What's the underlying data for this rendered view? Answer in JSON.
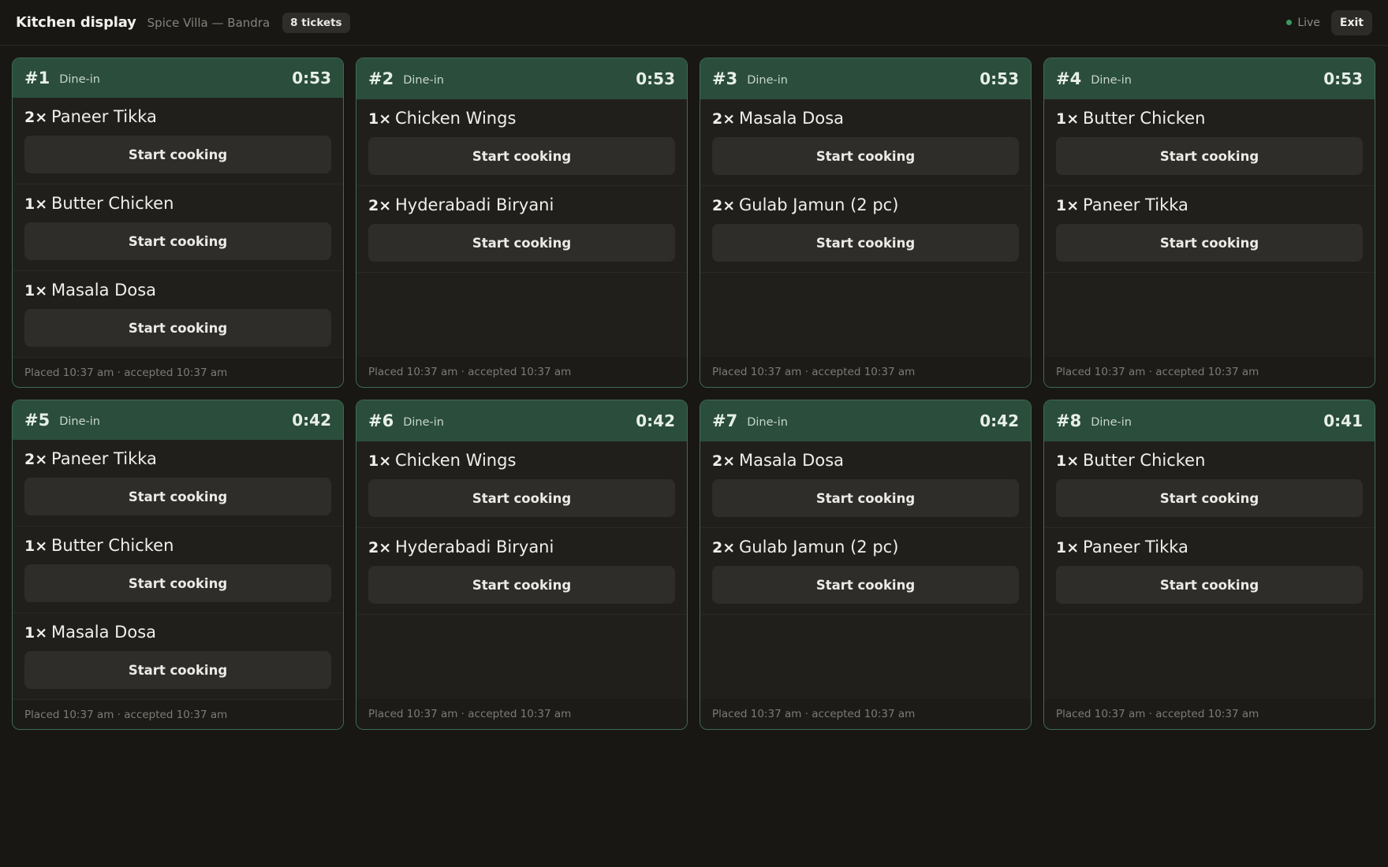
{
  "header": {
    "title": "Kitchen display",
    "location": "Spice Villa — Bandra",
    "ticket_count": "8 tickets",
    "live_label": "Live",
    "exit_label": "Exit"
  },
  "colors": {
    "background": "#181714",
    "ticket_header": "#2b4d3b",
    "ticket_border": "#3e6d52",
    "live_dot": "#3b9a61",
    "button": "#2f2d2a"
  },
  "tickets": [
    {
      "number": "#1",
      "type": "Dine-in",
      "timer": "0:53",
      "items": [
        {
          "qty": "2×",
          "name": "Paneer Tikka",
          "action": "Start cooking"
        },
        {
          "qty": "1×",
          "name": "Butter Chicken",
          "action": "Start cooking"
        },
        {
          "qty": "1×",
          "name": "Masala Dosa",
          "action": "Start cooking"
        }
      ],
      "footer": "Placed 10:37 am · accepted 10:37 am"
    },
    {
      "number": "#2",
      "type": "Dine-in",
      "timer": "0:53",
      "items": [
        {
          "qty": "1×",
          "name": "Chicken Wings",
          "action": "Start cooking"
        },
        {
          "qty": "2×",
          "name": "Hyderabadi Biryani",
          "action": "Start cooking"
        }
      ],
      "footer": "Placed 10:37 am · accepted 10:37 am"
    },
    {
      "number": "#3",
      "type": "Dine-in",
      "timer": "0:53",
      "items": [
        {
          "qty": "2×",
          "name": "Masala Dosa",
          "action": "Start cooking"
        },
        {
          "qty": "2×",
          "name": "Gulab Jamun (2 pc)",
          "action": "Start cooking"
        }
      ],
      "footer": "Placed 10:37 am · accepted 10:37 am"
    },
    {
      "number": "#4",
      "type": "Dine-in",
      "timer": "0:53",
      "items": [
        {
          "qty": "1×",
          "name": "Butter Chicken",
          "action": "Start cooking"
        },
        {
          "qty": "1×",
          "name": "Paneer Tikka",
          "action": "Start cooking"
        }
      ],
      "footer": "Placed 10:37 am · accepted 10:37 am"
    },
    {
      "number": "#5",
      "type": "Dine-in",
      "timer": "0:42",
      "items": [
        {
          "qty": "2×",
          "name": "Paneer Tikka",
          "action": "Start cooking"
        },
        {
          "qty": "1×",
          "name": "Butter Chicken",
          "action": "Start cooking"
        },
        {
          "qty": "1×",
          "name": "Masala Dosa",
          "action": "Start cooking"
        }
      ],
      "footer": "Placed 10:37 am · accepted 10:37 am"
    },
    {
      "number": "#6",
      "type": "Dine-in",
      "timer": "0:42",
      "items": [
        {
          "qty": "1×",
          "name": "Chicken Wings",
          "action": "Start cooking"
        },
        {
          "qty": "2×",
          "name": "Hyderabadi Biryani",
          "action": "Start cooking"
        }
      ],
      "footer": "Placed 10:37 am · accepted 10:37 am"
    },
    {
      "number": "#7",
      "type": "Dine-in",
      "timer": "0:42",
      "items": [
        {
          "qty": "2×",
          "name": "Masala Dosa",
          "action": "Start cooking"
        },
        {
          "qty": "2×",
          "name": "Gulab Jamun (2 pc)",
          "action": "Start cooking"
        }
      ],
      "footer": "Placed 10:37 am · accepted 10:37 am"
    },
    {
      "number": "#8",
      "type": "Dine-in",
      "timer": "0:41",
      "items": [
        {
          "qty": "1×",
          "name": "Butter Chicken",
          "action": "Start cooking"
        },
        {
          "qty": "1×",
          "name": "Paneer Tikka",
          "action": "Start cooking"
        }
      ],
      "footer": "Placed 10:37 am · accepted 10:37 am"
    }
  ]
}
